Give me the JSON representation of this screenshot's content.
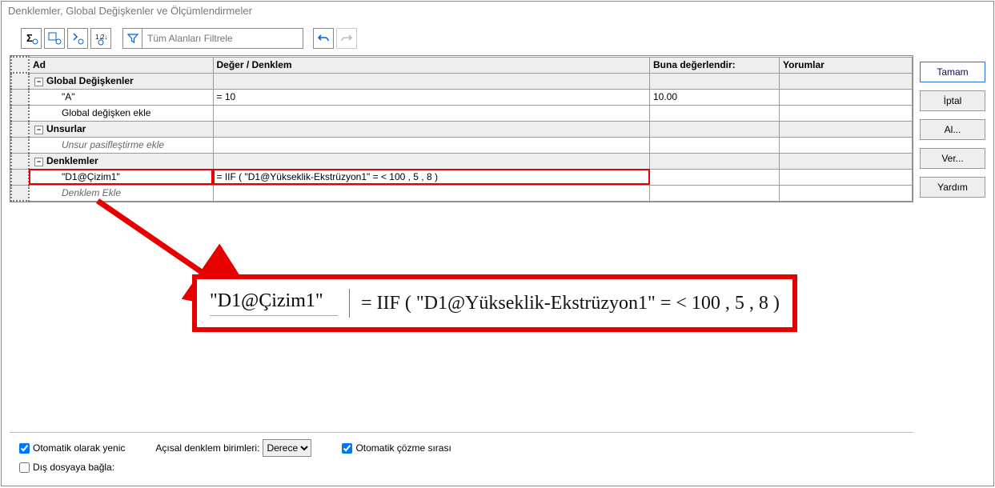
{
  "window": {
    "title": "Denklemler, Global Değişkenler ve Ölçümlendirmeler"
  },
  "filter": {
    "placeholder": "Tüm Alanları Filtrele"
  },
  "headers": {
    "name": "Ad",
    "value": "Değer / Denklem",
    "evaluate": "Buna değerlendir:",
    "comments": "Yorumlar"
  },
  "groups": {
    "globals": "Global Değişkenler",
    "globals_add": "Global değişken ekle",
    "features": "Unsurlar",
    "features_add": "Unsur pasifleştirme ekle",
    "equations": "Denklemler",
    "equations_add": "Denklem Ekle"
  },
  "rows": {
    "globalA": {
      "name": "\"A\"",
      "value": "= 10",
      "eval": "10.00"
    },
    "eq1": {
      "name": "\"D1@Çizim1\"",
      "value": "= IIF ( \"D1@Yükseklik-Ekstrüzyon1\" = < 100 , 5 , 8 )"
    }
  },
  "zoom": {
    "name": "\"D1@Çizim1\"",
    "value": "= IIF ( \"D1@Yükseklik-Ekstrüzyon1\" = < 100 , 5 , 8 )"
  },
  "bottom": {
    "auto_rebuild": "Otomatik olarak yenic",
    "units_label": "Açısal denklem birimleri:",
    "units_value": "Derece",
    "auto_solve": "Otomatik çözme sırası",
    "link_file": "Dış dosyaya bağla:"
  },
  "buttons": {
    "ok": "Tamam",
    "cancel": "İptal",
    "import": "Al...",
    "export": "Ver...",
    "help": "Yardım"
  },
  "icons": {
    "sigma": "Σ",
    "minus": "−"
  }
}
